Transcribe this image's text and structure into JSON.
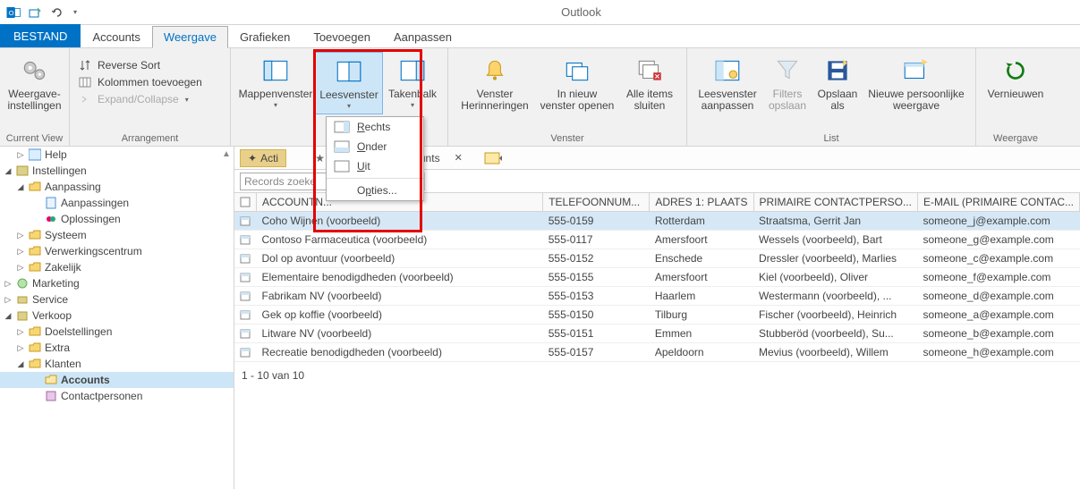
{
  "app_title": "Outlook",
  "tabs": {
    "file": "BESTAND",
    "accounts": "Accounts",
    "weergave": "Weergave",
    "grafieken": "Grafieken",
    "toevoegen": "Toevoegen",
    "aanpassen": "Aanpassen"
  },
  "ribbon": {
    "group_currentview": "Current View",
    "group_arrangement": "Arrangement",
    "group_venster": "Venster",
    "group_list": "List",
    "group_weergave": "Weergave",
    "weergave_instellingen": "Weergave-\ninstellingen",
    "reverse_sort": "Reverse Sort",
    "kolommen_toevoegen": "Kolommen toevoegen",
    "expand_collapse": "Expand/Collapse",
    "mappenvenster": "Mappenvenster",
    "leesvenster": "Leesvenster",
    "takenbalk": "Takenbalk",
    "venster_herinneringen": "Venster\nHerinneringen",
    "in_nieuw_venster": "In nieuw\nvenster openen",
    "alle_items_sluiten": "Alle items\nsluiten",
    "leesvenster_aanpassen": "Leesvenster\naanpassen",
    "filters_opslaan": "Filters\nopslaan",
    "opslaan_als": "Opslaan\nals",
    "nieuwe_persoonlijke": "Nieuwe persoonlijke\nweergave",
    "vernieuwen": "Vernieuwen"
  },
  "dropdown": {
    "rechts": "Rechts",
    "onder": "Onder",
    "uit": "Uit",
    "opties": "Opties..."
  },
  "nav": {
    "help": "Help",
    "instellingen": "Instellingen",
    "aanpassing": "Aanpassing",
    "aanpassingen": "Aanpassingen",
    "oplossingen": "Oplossingen",
    "systeem": "Systeem",
    "verwerkingscentrum": "Verwerkingscentrum",
    "zakelijk": "Zakelijk",
    "marketing": "Marketing",
    "service": "Service",
    "verkoop": "Verkoop",
    "doelstellingen": "Doelstellingen",
    "extra": "Extra",
    "klanten": "Klanten",
    "accounts": "Accounts",
    "contactpersonen": "Contactpersonen"
  },
  "viewbar": {
    "acties": "Acti",
    "mijn_actieve": "Mijn actieve accounts"
  },
  "search_placeholder": "Records zoeke",
  "columns": {
    "account": "ACCOUNTN...",
    "telefoon": "TELEFOONNUM...",
    "adres": "ADRES 1: PLAATS",
    "primaire": "PRIMAIRE CONTACTPERSO...",
    "email": "E-MAIL (PRIMAIRE CONTAC..."
  },
  "rows": [
    {
      "name": "Coho Wijnen (voorbeeld)",
      "tel": "555-0159",
      "plaats": "Rotterdam",
      "contact": "Straatsma, Gerrit Jan",
      "email": "someone_j@example.com"
    },
    {
      "name": "Contoso Farmaceutica (voorbeeld)",
      "tel": "555-0117",
      "plaats": "Amersfoort",
      "contact": "Wessels (voorbeeld), Bart",
      "email": "someone_g@example.com"
    },
    {
      "name": "Dol op avontuur (voorbeeld)",
      "tel": "555-0152",
      "plaats": "Enschede",
      "contact": "Dressler (voorbeeld), Marlies",
      "email": "someone_c@example.com"
    },
    {
      "name": "Elementaire benodigdheden (voorbeeld)",
      "tel": "555-0155",
      "plaats": "Amersfoort",
      "contact": "Kiel (voorbeeld), Oliver",
      "email": "someone_f@example.com"
    },
    {
      "name": "Fabrikam NV (voorbeeld)",
      "tel": "555-0153",
      "plaats": "Haarlem",
      "contact": "Westermann (voorbeeld), ...",
      "email": "someone_d@example.com"
    },
    {
      "name": "Gek op koffie (voorbeeld)",
      "tel": "555-0150",
      "plaats": "Tilburg",
      "contact": "Fischer (voorbeeld), Heinrich",
      "email": "someone_a@example.com"
    },
    {
      "name": "Litware NV (voorbeeld)",
      "tel": "555-0151",
      "plaats": "Emmen",
      "contact": "Stubberöd (voorbeeld), Su...",
      "email": "someone_b@example.com"
    },
    {
      "name": "Recreatie benodigdheden (voorbeeld)",
      "tel": "555-0157",
      "plaats": "Apeldoorn",
      "contact": "Mevius (voorbeeld), Willem",
      "email": "someone_h@example.com"
    }
  ],
  "footer_count": "1 - 10 van 10"
}
